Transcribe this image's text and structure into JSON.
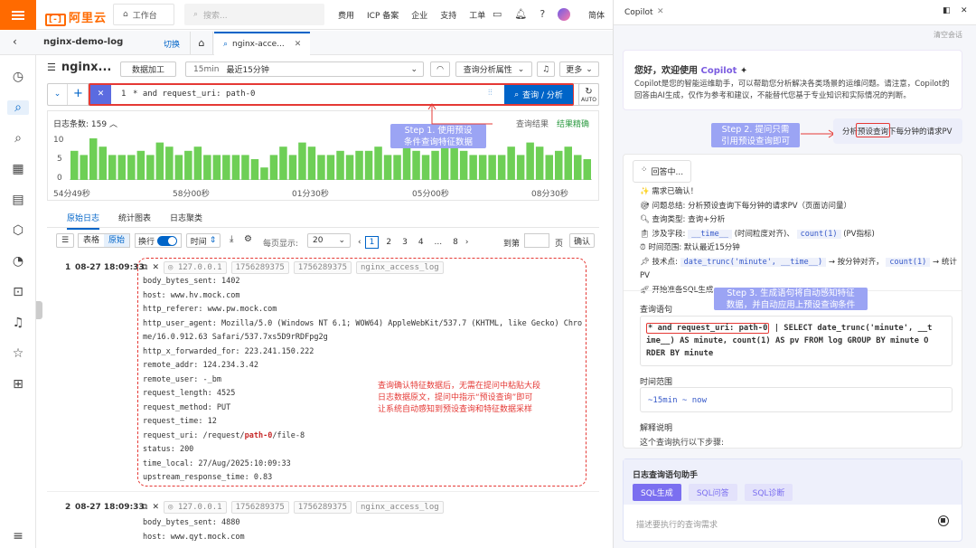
{
  "topbar": {
    "logo": "阿里云",
    "workbench": "工作台",
    "search_placeholder": "搜索...",
    "links": [
      "费用",
      "ICP 备案",
      "企业",
      "支持",
      "工单"
    ],
    "lang": "简体"
  },
  "tabs": {
    "project": "nginx-demo-log",
    "switch": "切换",
    "active_tab": "nginx-acce..."
  },
  "toolbar": {
    "logstore": "nginx...",
    "data_process": "数据加工",
    "time_short": "15min",
    "time_range": "最近15分钟",
    "analysis_props": "查询分析属性",
    "more": "更多"
  },
  "query": {
    "line_no": "1",
    "text": "* and request_uri: path-0",
    "submit": "查询 / 分析",
    "auto": "AUTO"
  },
  "histogram": {
    "count_label": "日志条数:",
    "count": "159",
    "result_label": "查询结果",
    "result_status": "结果精确",
    "y_ticks": [
      "10",
      "5",
      "0"
    ],
    "x_ticks": [
      "54分49秒",
      "58分00秒",
      "01分30秒",
      "05分00秒",
      "08分30秒"
    ],
    "values": [
      7,
      6,
      10,
      8,
      6,
      6,
      6,
      7,
      6,
      9,
      8,
      6,
      7,
      8,
      6,
      6,
      6,
      6,
      6,
      5,
      3,
      6,
      8,
      6,
      9,
      8,
      6,
      6,
      7,
      6,
      7,
      7,
      8,
      6,
      6,
      8,
      7,
      6,
      7,
      8,
      9,
      7,
      6,
      6,
      6,
      6,
      8,
      6,
      9,
      8,
      6,
      7,
      8,
      6,
      5
    ]
  },
  "logtabs": [
    "原始日志",
    "统计图表",
    "日志聚类"
  ],
  "logtoolbar": {
    "table": "表格",
    "raw": "原始",
    "wrap": "换行",
    "time": "时间",
    "per_page": "每页显示:",
    "page_size": "20",
    "jump": "到第",
    "page_unit": "页",
    "confirm": "确认",
    "pages": [
      "1",
      "2",
      "3",
      "4",
      "...",
      "8"
    ]
  },
  "log1": {
    "no": "1",
    "time": "08-27 18:09:33",
    "tags": [
      "127.0.0.1",
      "1756289375",
      "1756289375",
      "nginx_access_log"
    ],
    "fields": [
      [
        "body_bytes_sent:",
        "1402"
      ],
      [
        "host:",
        "www.hv.mock.com"
      ],
      [
        "http_referer:",
        "www.pw.mock.com"
      ],
      [
        "http_user_agent:",
        "Mozilla/5.0 (Windows NT 6.1; WOW64) AppleWebKit/537.7 (KHTML, like Gecko) Chro"
      ],
      [
        "",
        "me/16.0.912.63 Safari/537.7xs5D9rRDFpg2g"
      ],
      [
        "http_x_forwarded_for:",
        "223.241.150.222"
      ],
      [
        "remote_addr:",
        "124.234.3.42"
      ],
      [
        "remote_user:",
        "-_bm"
      ],
      [
        "request_length:",
        "4525"
      ],
      [
        "request_method:",
        "PUT"
      ],
      [
        "request_time:",
        "12"
      ],
      [
        "request_uri:",
        "/request/path-0/file-8"
      ],
      [
        "status:",
        "200"
      ],
      [
        "time_local:",
        "27/Aug/2025:10:09:33"
      ],
      [
        "upstream_response_time:",
        "0.83"
      ]
    ]
  },
  "log2": {
    "no": "2",
    "time": "08-27 18:09:33",
    "tags": [
      "127.0.0.1",
      "1756289375",
      "1756289375",
      "nginx_access_log"
    ],
    "fields": [
      [
        "body_bytes_sent:",
        "4880"
      ],
      [
        "host:",
        "www.qyt.mock.com"
      ]
    ]
  },
  "annotations": {
    "step1": [
      "Step 1. 使用预设",
      "条件查询特征数据"
    ],
    "step2": [
      "Step 2. 提问只需",
      "引用预设查询即可"
    ],
    "step3": [
      "Step 3. 生成语句将自动感知特征",
      "数据，并自动应用上预设查询条件"
    ],
    "note": [
      "查询确认特征数据后，无需在提问中粘贴大段",
      "日志数据原文，提问中指示“预设查询”即可",
      "让系统自动感知到预设查询和特征数据采样"
    ]
  },
  "copilot": {
    "title": "Copilot",
    "clear": "清空会话",
    "welcome_title": "您好，欢迎使用",
    "welcome_brand": "Copilot",
    "welcome_body": [
      "Copilot是您的智能运维助手，可以帮助您分析解决各类场景的运维问题。请注意，Copilot的",
      "回答由AI生成，仅作为参考和建议，不能替代您基于专业知识和实际情况的判断。"
    ],
    "question": "分析预设查询下每分钟的请求PV",
    "answering": "回答中...",
    "steps": [
      "需求已确认！",
      "问题总结: 分析预设查询下每分钟的请求PV（页面访问量）",
      "查询类型: 查询+分析",
      "涉及字段:",
      "时间范围: 默认最近15分钟",
      "技术点:",
      "开始准备SQL生成..."
    ],
    "field1": "__time__",
    "field1_desc": "(时间粒度对齐)、",
    "field2": "count(1)",
    "field2_desc": "(PV指标)",
    "tech1": "date_trunc('minute', __time__)",
    "tech1_desc": "→ 按分钟对齐，",
    "tech2": "count(1)",
    "tech2_desc": "→ 统计PV",
    "query_label": "查询语句",
    "sql_pre": "* and request_uri: path-0",
    "sql_rest": [
      "| SELECT date_trunc('minute', __t",
      "ime__) AS minute, count(1) AS pv FROM log GROUP BY minute O",
      "RDER BY minute"
    ],
    "time_label": "时间范围",
    "time_value": "~15min ~ now",
    "explain_label": "解释说明",
    "explain_text": "这个查询执行以下步骤:",
    "assistant_title": "日志查询语句助手",
    "assistant_tabs": [
      "SQL生成",
      "SQL问答",
      "SQL诊断"
    ],
    "input_placeholder": "描述要执行的查询需求"
  }
}
